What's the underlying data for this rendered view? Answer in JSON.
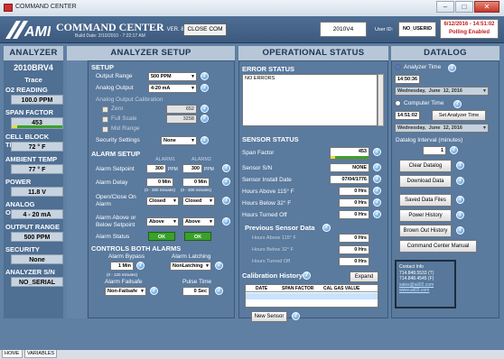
{
  "window": {
    "title": "COMMAND CENTER"
  },
  "header": {
    "app_title": "COMMAND CENTER",
    "version": "VER. 8.0",
    "build_date": "Build Date: 2/10/2010 - 7:22:17 AM",
    "close_com": "CLOSE COM",
    "serial": "2010V4",
    "user_id_label": "User ID:",
    "user_id": "NO_USERID",
    "datetime": "6/12/2016 - 14:51:02",
    "polling": "Polling Enabled"
  },
  "columns": {
    "analyzer_info": "ANALYZER INFO",
    "analyzer_setup": "ANALYZER SETUP",
    "operational_status": "OPERATIONAL STATUS",
    "datalog": "DATALOG"
  },
  "analyzer_info": {
    "model": "2010BRV4",
    "status": "Trace",
    "o2_label": "O2 READING",
    "o2_value": "100.0 PPM",
    "span_label": "SPAN FACTOR",
    "span_value": "453",
    "cell_temp_label": "CELL BLOCK TEMP",
    "cell_temp_value": "72 ° F",
    "ambient_label": "AMBIENT TEMP",
    "ambient_value": "77 ° F",
    "power_label": "POWER",
    "power_value": "11.8 V",
    "analog_label": "ANALOG OUTPUT",
    "analog_value": "4 - 20 mA",
    "range_label": "OUTPUT RANGE",
    "range_value": "500 PPM",
    "security_label": "SECURITY",
    "security_value": "None",
    "serial_label": "ANALYZER S/N",
    "serial_value": "NO_SERIAL"
  },
  "setup": {
    "title": "SETUP",
    "output_range_label": "Output Range",
    "output_range": "500 PPM",
    "analog_output_label": "Analog Output",
    "analog_output": "4-20 mA",
    "calibration_label": "Analog Output Calibration",
    "zero_label": "Zero",
    "zero_value": "652",
    "full_scale_label": "Full Scale",
    "full_scale_value": "3258",
    "mid_range_label": "Mid Range",
    "security_settings_label": "Security Settings",
    "security_settings": "None"
  },
  "alarm_setup": {
    "title": "ALARM SETUP",
    "alarm1": "ALARM1",
    "alarm2": "ALARM2",
    "setpoint_label": "Alarm Setpoint",
    "setpoint1": "300",
    "setpoint2": "300",
    "unit_ppm": "PPM",
    "delay_label": "Alarm Delay",
    "delay1": "0 Min",
    "delay2": "0 Min",
    "delay_hint": "(0 - 300 minutes)",
    "open_close_label": "Open/Close On Alarm",
    "open_close1": "Closed",
    "open_close2": "Closed",
    "above_below_label": "Alarm Above or Below Setpoint",
    "above_below1": "Above",
    "above_below2": "Above",
    "status_label": "Alarm Status",
    "status1": "OK",
    "status2": "OK"
  },
  "controls_both": {
    "title": "CONTROLS BOTH ALARMS",
    "bypass_label": "Alarm Bypass",
    "bypass_value": "1 Min",
    "bypass_hint": "(0 - 120 minutes)",
    "latching_label": "Alarm Latching",
    "latching_value": "NonLatching",
    "failsafe_label": "Alarm Failsafe",
    "failsafe_value": "Non-Failsafe",
    "pulse_label": "Pulse Time",
    "pulse_value": "0 Sec"
  },
  "error_status": {
    "title": "ERROR STATUS",
    "text": "NO ERRORS"
  },
  "sensor_status": {
    "title": "SENSOR STATUS",
    "span_label": "Span Factor",
    "span_value": "453",
    "sn_label": "Sensor S/N",
    "sn_value": "NONE",
    "install_label": "Sensor Install Date",
    "install_value": "07/04/1776",
    "above115_label": "Hours Above 115° F",
    "above115_value": "0 Hrs",
    "below32_label": "Hours Below 32° F",
    "below32_value": "0 Hrs",
    "turned_off_label": "Hours Turned Off",
    "turned_off_value": "0 Hrs"
  },
  "previous_sensor": {
    "title": "Previous Sensor Data",
    "above115_label": "Hours Above 115° F",
    "above115_value": "0 Hrs",
    "below32_label": "Hours Below 32° F",
    "below32_value": "0 Hrs",
    "turned_off_label": "Hours Turned Off",
    "turned_off_value": "0 Hrs"
  },
  "calibration_history": {
    "title": "Calibration History",
    "expand": "Expand",
    "col_date": "DATE",
    "col_span": "SPAN FACTOR",
    "col_cal": "CAL GAS VALUE",
    "new_sensor": "New Sensor"
  },
  "datalog": {
    "analyzer_time_label": "Analyzer Time",
    "analyzer_time": "14:50:36",
    "analyzer_date_day": "Wednesday,",
    "analyzer_date_month": "June",
    "analyzer_date_num": "12, 2016",
    "computer_time_label": "Computer Time",
    "computer_time": "14:51:02",
    "set_analyzer_time": "Set Analyzer Time",
    "computer_date_day": "Wednesday,",
    "computer_date_month": "June",
    "computer_date_num": "12, 2016",
    "interval_label": "Datalog Interval (minutes)",
    "interval_value": "1",
    "clear_datalog": "Clear Datalog",
    "download_data": "Download Data",
    "saved_data_files": "Saved Data Files",
    "power_history": "Power History",
    "brown_out_history": "Brown Out History",
    "command_center_manual": "Command Center Manual"
  },
  "contact": {
    "title": "Contact Info",
    "phone1": "714.848.5533 (T)",
    "phone2": "714.848.4545 (F)",
    "email": "sales@aii02.com",
    "web": "www.aii02.com"
  },
  "tabs": {
    "home": "HOME",
    "variables": "VARIABLES"
  },
  "colors": {
    "accent": "#5a7a9e",
    "ok": "#3aa12a",
    "alert": "#c11d1d"
  }
}
